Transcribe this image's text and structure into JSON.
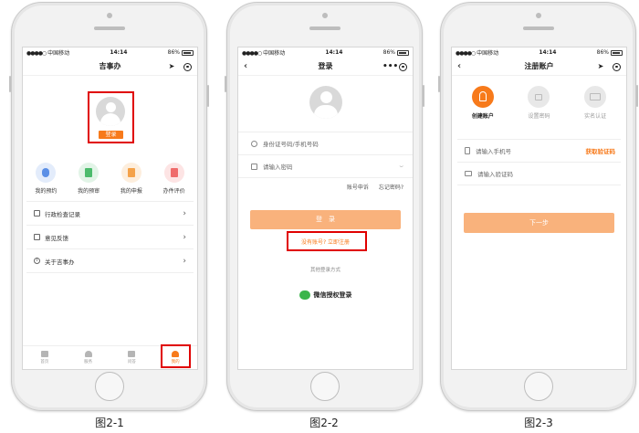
{
  "status": {
    "carrier": "中国移动",
    "time": "14:14",
    "battery": "86%"
  },
  "screen1": {
    "title": "吉事办",
    "login_button": "登录",
    "quick_actions": [
      {
        "label": "我的预约",
        "color": "#5b8fe6"
      },
      {
        "label": "我的预审",
        "color": "#4cbb6c"
      },
      {
        "label": "我的申报",
        "color": "#f4a24a"
      },
      {
        "label": "办件评价",
        "color": "#ef6b6b"
      }
    ],
    "menu": [
      {
        "label": "行政检查记录"
      },
      {
        "label": "意见反馈"
      },
      {
        "label": "关于吉事办"
      }
    ],
    "tabs": [
      {
        "label": "首页"
      },
      {
        "label": "服务"
      },
      {
        "label": "问答"
      },
      {
        "label": "我的"
      }
    ],
    "caption": "图2-1"
  },
  "screen2": {
    "title": "登录",
    "id_placeholder": "身份证号码/手机号码",
    "password_placeholder": "请输入密码",
    "account_appeal": "账号申诉",
    "forgot_password": "忘记密码?",
    "login_button": "登　录",
    "register_prompt": "没有账号? 立即注册",
    "other_login": "其他登录方式",
    "wechat_login": "微信授权登录",
    "caption": "图2-2"
  },
  "screen3": {
    "title": "注册账户",
    "steps": [
      {
        "label": "创建账户"
      },
      {
        "label": "设置密码"
      },
      {
        "label": "实名认证"
      }
    ],
    "phone_placeholder": "请输入手机号",
    "get_code": "获取验证码",
    "code_placeholder": "请输入验证码",
    "next_button": "下一步",
    "caption": "图2-3"
  },
  "colors": {
    "accent": "#f77a1b",
    "highlight_red": "#e00000",
    "muted_button": "#f9b27c"
  }
}
